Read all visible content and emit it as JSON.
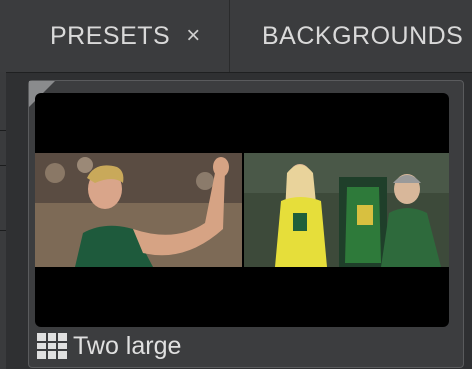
{
  "tabs": [
    {
      "label": "PRESETS",
      "close_glyph": "×",
      "active": true
    },
    {
      "label": "BACKGROUNDS",
      "active": false
    }
  ],
  "preset_card": {
    "label": "Two large",
    "layout_icon": "grid-layout-icon",
    "thumbnail_content": "two-photo-layout"
  },
  "colors": {
    "background": "#2e2f31",
    "tab_bar": "#3b3c3e",
    "card": "#3c3d3f",
    "text": "#d9d9d9"
  }
}
